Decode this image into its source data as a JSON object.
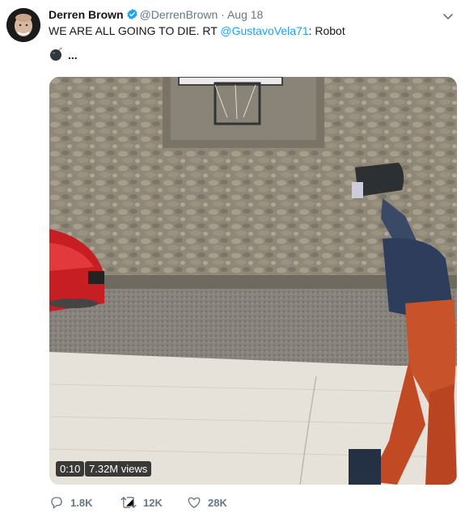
{
  "author": {
    "name": "Derren Brown",
    "handle": "@DerrenBrown",
    "separator": "·",
    "date": "Aug 18"
  },
  "tweet": {
    "text_before": "WE ARE ALL GOING TO DIE.  RT ",
    "mention": "@GustavoVela71",
    "text_after": ": Robot",
    "continuation": "..."
  },
  "media": {
    "duration": "0:10",
    "views": "7.32M views"
  },
  "actions": {
    "replies": "1.8K",
    "retweets": "12K",
    "likes": "28K"
  },
  "colors": {
    "link": "#1da1f2",
    "muted": "#657786",
    "verified": "#1da1f2"
  },
  "icons": [
    "verified-badge-icon",
    "chevron-down-icon",
    "bomb-emoji-icon",
    "reply-icon",
    "retweet-icon",
    "like-heart-icon"
  ]
}
